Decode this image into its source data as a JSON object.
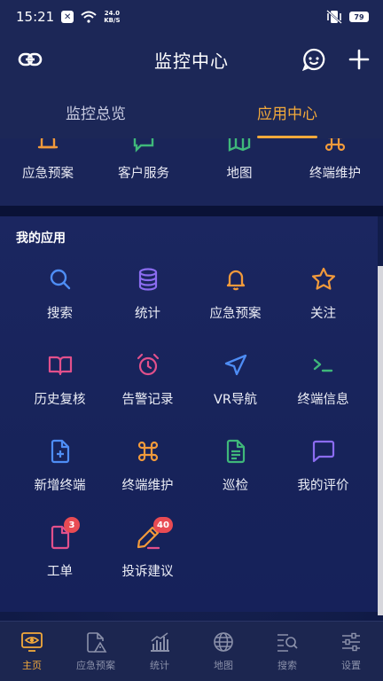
{
  "status": {
    "time": "15:21",
    "speed_top": "24.0",
    "speed_bottom": "KB/S",
    "battery": "79"
  },
  "header": {
    "title": "监控中心"
  },
  "tabs": [
    {
      "label": "监控总览"
    },
    {
      "label": "应用中心"
    }
  ],
  "top_row": [
    {
      "label": "应急预案",
      "icon": "alarm-icon"
    },
    {
      "label": "客户服务",
      "icon": "message-icon"
    },
    {
      "label": "地图",
      "icon": "map-icon"
    },
    {
      "label": "终端维护",
      "icon": "command-icon"
    }
  ],
  "my_apps": {
    "title": "我的应用",
    "items": [
      {
        "label": "搜索",
        "icon": "search-icon"
      },
      {
        "label": "统计",
        "icon": "database-icon"
      },
      {
        "label": "应急预案",
        "icon": "bell-icon"
      },
      {
        "label": "关注",
        "icon": "star-icon"
      },
      {
        "label": "历史复核",
        "icon": "book-icon"
      },
      {
        "label": "告警记录",
        "icon": "alarm-clock-icon"
      },
      {
        "label": "VR导航",
        "icon": "navigation-icon"
      },
      {
        "label": "终端信息",
        "icon": "terminal-icon"
      },
      {
        "label": "新增终端",
        "icon": "file-plus-icon"
      },
      {
        "label": "终端维护",
        "icon": "command-icon"
      },
      {
        "label": "巡检",
        "icon": "file-text-icon"
      },
      {
        "label": "我的评价",
        "icon": "message-square-icon"
      },
      {
        "label": "工单",
        "icon": "file-icon",
        "badge": "3"
      },
      {
        "label": "投诉建议",
        "icon": "pen-icon",
        "badge": "40"
      }
    ]
  },
  "bottom_nav": [
    {
      "label": "主页",
      "icon": "eye-monitor-icon"
    },
    {
      "label": "应急预案",
      "icon": "warning-doc-icon"
    },
    {
      "label": "统计",
      "icon": "bar-chart-icon"
    },
    {
      "label": "地图",
      "icon": "globe-icon"
    },
    {
      "label": "搜索",
      "icon": "list-search-icon"
    },
    {
      "label": "设置",
      "icon": "sliders-icon"
    }
  ],
  "colors": {
    "accent": "#f2a93b",
    "blue": "#4e8df5",
    "purple": "#8b6cf0",
    "pink": "#e2508b",
    "green": "#3fb87a",
    "orange": "#f29a3b",
    "badge": "#e94b53"
  }
}
